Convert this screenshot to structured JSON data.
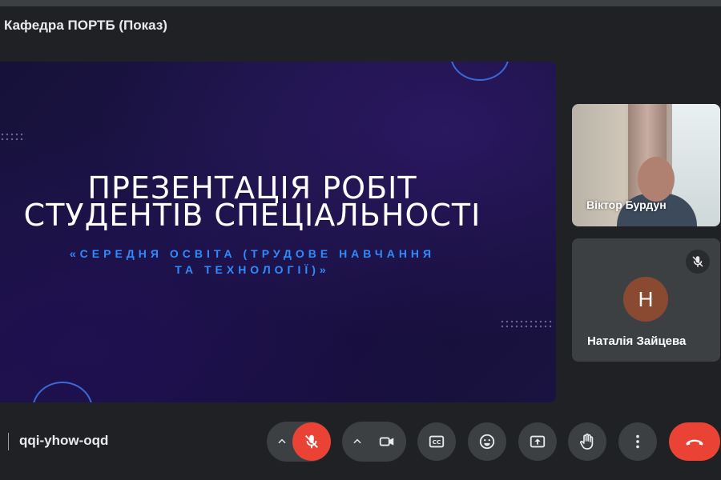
{
  "meeting": {
    "title": "Кафедра ПОРТБ (Показ)",
    "code": "qqi-yhow-oqd"
  },
  "slide": {
    "title_line1": "ПРЕЗЕНТАЦІЯ РОБІТ",
    "title_line2": "СТУДЕНТІВ СПЕЦІАЛЬНОСТІ",
    "subtitle_line1": "«СЕРЕДНЯ ОСВІТА (ТРУДОВЕ НАВЧАННЯ",
    "subtitle_line2": "ТА ТЕХНОЛОГІЇ)»",
    "subtitle_color": "#2f8cff"
  },
  "participants": [
    {
      "name": "Віктор Бурдун",
      "type": "video"
    },
    {
      "name": "Наталія Зайцева",
      "type": "avatar",
      "initial": "Н",
      "avatar_color": "#8a4a32",
      "muted": true
    }
  ],
  "controls": {
    "mic": {
      "icon": "mic-off-icon",
      "state": "off",
      "color": "#ea4335"
    },
    "camera": {
      "icon": "camera-icon"
    },
    "captions": {
      "icon": "cc-icon"
    },
    "reactions": {
      "icon": "emoji-icon"
    },
    "present": {
      "icon": "present-screen-icon"
    },
    "raise_hand": {
      "icon": "hand-icon"
    },
    "more": {
      "icon": "more-vert-icon"
    },
    "leave": {
      "icon": "call-end-icon",
      "color": "#ea4335"
    }
  }
}
